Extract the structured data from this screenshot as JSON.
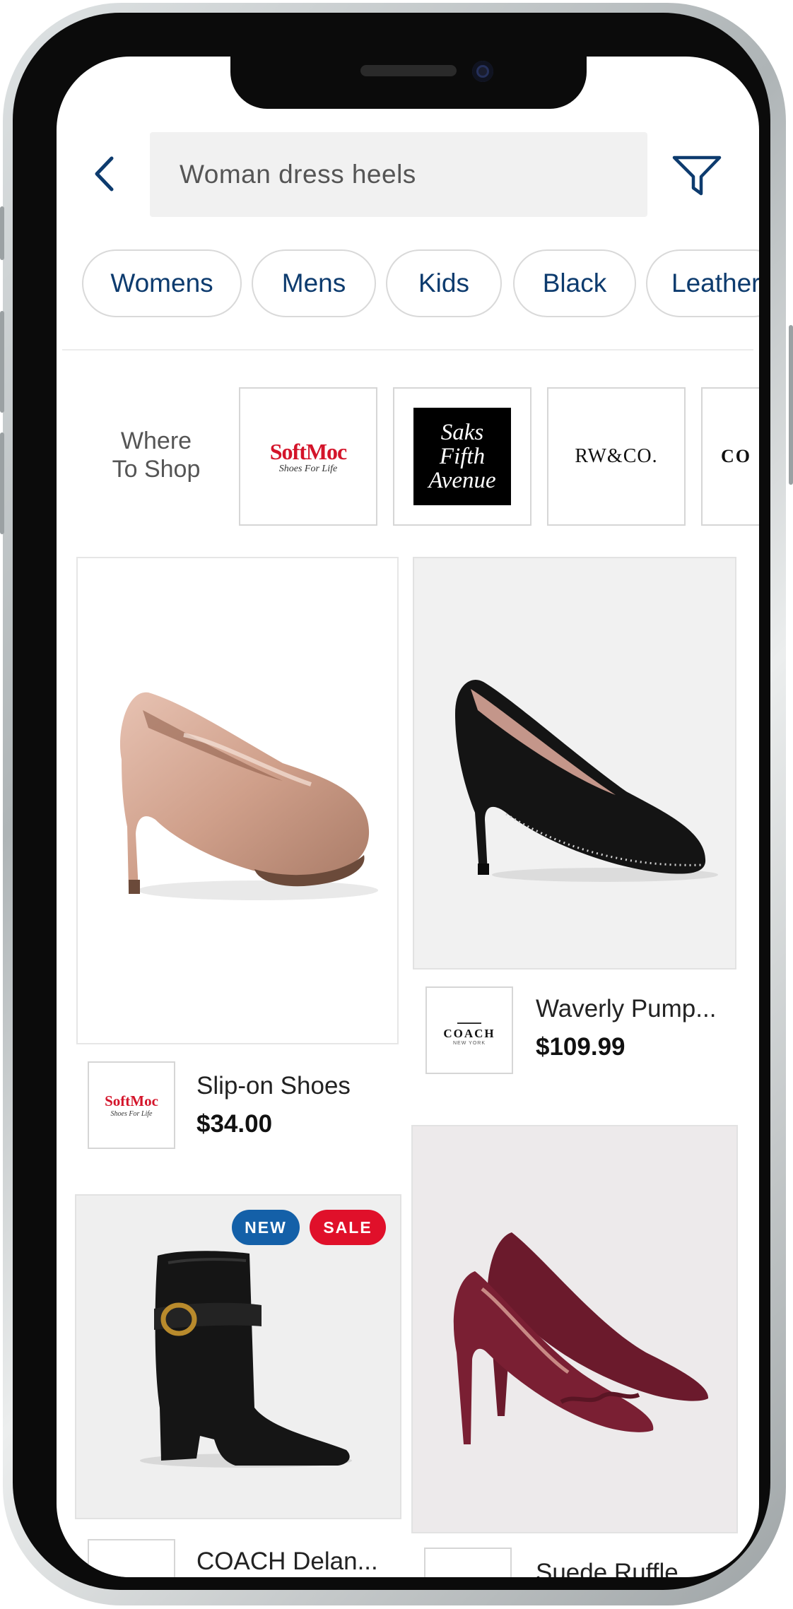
{
  "search": {
    "query": "Woman dress heels"
  },
  "chips": [
    "Womens",
    "Mens",
    "Kids",
    "Black",
    "Leather"
  ],
  "where_to_shop": {
    "label_line1": "Where",
    "label_line2": "To Shop",
    "stores": [
      {
        "name": "SoftMoc",
        "tagline": "Shoes For Life"
      },
      {
        "name_line1": "Saks",
        "name_line2": "Fifth",
        "name_line3": "Avenue"
      },
      {
        "name": "RW&CO."
      },
      {
        "name": "CO"
      }
    ]
  },
  "products": [
    {
      "name": "Slip-on Shoes",
      "price": "$34.00",
      "store": "SoftMoc",
      "store_tagline": "Shoes For Life"
    },
    {
      "name": "Waverly Pump...",
      "price": "$109.99",
      "store": "COACH",
      "store_sub": "NEW YORK"
    },
    {
      "name": "COACH Delan...",
      "price": "",
      "badges": [
        "NEW",
        "SALE"
      ]
    },
    {
      "name": "Suede Ruffle...",
      "price": ""
    }
  ],
  "colors": {
    "accent_navy": "#0d3b6e",
    "badge_new": "#1460a8",
    "badge_sale": "#e0102a",
    "softmoc_red": "#d4142a"
  }
}
